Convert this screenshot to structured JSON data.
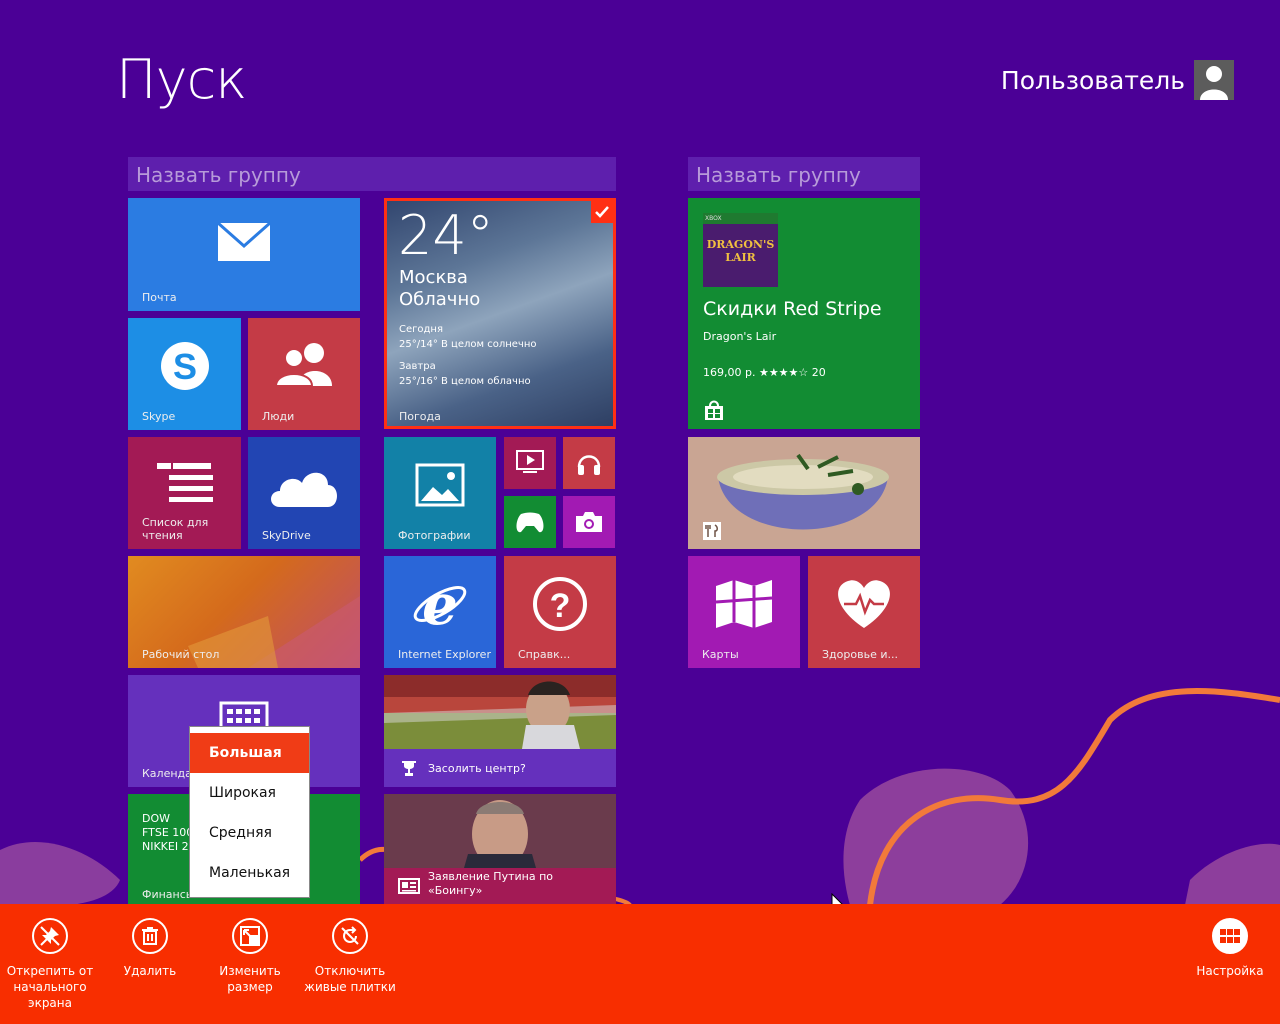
{
  "start": {
    "title": "Пуск",
    "user_name": "Пользователь"
  },
  "groups": [
    {
      "name": "Назвать группу"
    },
    {
      "name": "Назвать группу"
    }
  ],
  "tiles": {
    "mail": "Почта",
    "skype": "Skype",
    "people": "Люди",
    "reading_list": "Список для чтения",
    "skydrive": "SkyDrive",
    "desktop": "Рабочий стол",
    "calendar": "Календарь",
    "finance": {
      "label": "Финансы",
      "indices": [
        "DOW",
        "FTSE 100",
        "NIKKEI 22"
      ]
    },
    "weather": {
      "temp": "24°",
      "city": "Москва",
      "condition": "Облачно",
      "today_label": "Сегодня",
      "today": "25°/14° В целом солнечно",
      "tomorrow_label": "Завтра",
      "tomorrow": "25°/16° В целом облачно",
      "label": "Погода"
    },
    "photos": "Фотографии",
    "ie": "Internet Explorer",
    "help": "Справк...",
    "sport": "Засолить центр?",
    "news": "Заявление Путина по «Боингу»",
    "store": {
      "badge": "XBOX",
      "title": "Скидки Red Stripe",
      "subtitle": "Dragon's Lair",
      "price": "169,00 р. ★★★★☆ 20",
      "box_art_text": "DRAGON'S LAIR"
    },
    "maps": "Карты",
    "health": "Здоровье и..."
  },
  "resize_menu": {
    "items": [
      "Большая",
      "Широкая",
      "Средняя",
      "Маленькая"
    ],
    "selected": "Большая"
  },
  "appbar": {
    "unpin": "Открепить от начального экрана",
    "delete": "Удалить",
    "resize": "Изменить размер",
    "live_off": "Отключить живые плитки",
    "customize": "Настройка"
  },
  "colors": {
    "background": "#4b0096",
    "appbar": "#f82e00",
    "selected_border": "#ff3014",
    "mail": "#2b7ce2",
    "skype": "#1d8ee5",
    "people": "#c43b46",
    "reading_list": "#a31a55",
    "skydrive": "#2245b3",
    "photos": "#1281a7",
    "ie": "#2a66d8",
    "help": "#c43b46",
    "store": "#128c33",
    "maps": "#a21ab3",
    "health": "#c43b46",
    "calendar": "#6530bd",
    "finance": "#128c33"
  }
}
